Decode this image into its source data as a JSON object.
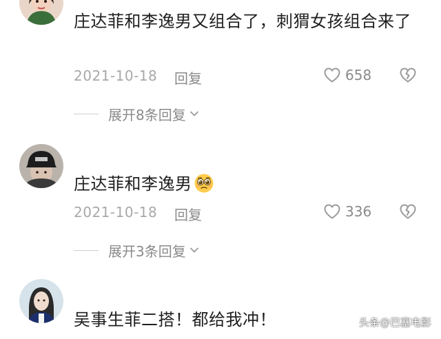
{
  "comments": [
    {
      "text": "庄达菲和李逸男又组合了，刺猬女孩组合来了",
      "date": "2021-10-18",
      "reply_label": "回复",
      "likes": "658",
      "expand_label": "展开8条回复"
    },
    {
      "text": "庄达菲和李逸男",
      "emoji": "pleading-face-emoji",
      "date": "2021-10-18",
      "reply_label": "回复",
      "likes": "336",
      "expand_label": "展开3条回复"
    },
    {
      "text": "吴事生菲二搭！都给我冲！"
    }
  ],
  "watermark": "头条@巴塞电影",
  "colors": {
    "meta_gray": "#a8a8a8",
    "text": "#1f1f1f"
  },
  "icons": [
    "heart-icon",
    "broken-heart-icon",
    "chevron-down-icon"
  ]
}
